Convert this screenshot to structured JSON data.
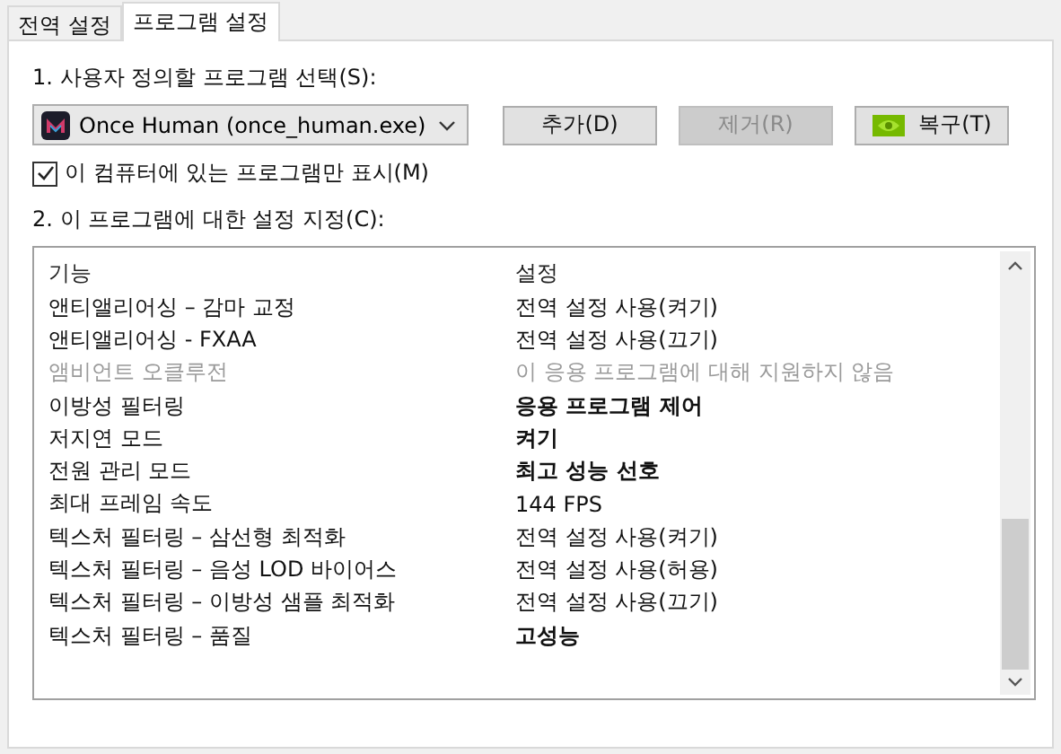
{
  "tabs": [
    {
      "label": "전역 설정",
      "selected": false
    },
    {
      "label": "프로그램 설정",
      "selected": true
    }
  ],
  "program_select": {
    "label": "1. 사용자 정의할 프로그램 선택(S):",
    "value": "Once Human (once_human.exe)"
  },
  "buttons": [
    {
      "label": "추가(D)",
      "disabled": false,
      "kind": "plain"
    },
    {
      "label": "제거(R)",
      "disabled": true,
      "kind": "plain"
    },
    {
      "label": "복구(T)",
      "disabled": false,
      "kind": "logo"
    }
  ],
  "show_installed_only": {
    "label": "이 컴퓨터에 있는 프로그램만 표시(M)",
    "checked": true
  },
  "settings_label": "2. 이 프로그램에 대한 설정 지정(C):",
  "table": {
    "columns": [
      "기능",
      "설정"
    ],
    "rows": [
      {
        "feature": "앤티앨리어싱 – 감마 교정",
        "setting": "전역 설정 사용(켜기)",
        "disabled": false,
        "modified": false
      },
      {
        "feature": "앤티앨리어싱 - FXAA",
        "setting": "전역 설정 사용(끄기)",
        "disabled": false,
        "modified": false
      },
      {
        "feature": "앰비언트 오클루전",
        "setting": "이 응용 프로그램에 대해 지원하지 않음",
        "disabled": true,
        "modified": false
      },
      {
        "feature": "이방성 필터링",
        "setting": "응용 프로그램 제어",
        "disabled": false,
        "modified": true
      },
      {
        "feature": "저지연 모드",
        "setting": "켜기",
        "disabled": false,
        "modified": true
      },
      {
        "feature": "전원 관리 모드",
        "setting": "최고 성능 선호",
        "disabled": false,
        "modified": true
      },
      {
        "feature": "최대 프레임 속도",
        "setting": "144 FPS",
        "disabled": false,
        "modified": false
      },
      {
        "feature": "텍스처 필터링 – 삼선형 최적화",
        "setting": "전역 설정 사용(켜기)",
        "disabled": false,
        "modified": false
      },
      {
        "feature": "텍스처 필터링 – 음성 LOD 바이어스",
        "setting": "전역 설정 사용(허용)",
        "disabled": false,
        "modified": false
      },
      {
        "feature": "텍스처 필터링 – 이방성 샘플 최적화",
        "setting": "전역 설정 사용(끄기)",
        "disabled": false,
        "modified": false
      },
      {
        "feature": "텍스처 필터링 – 품질",
        "setting": "고성능",
        "disabled": false,
        "modified": true
      }
    ]
  }
}
